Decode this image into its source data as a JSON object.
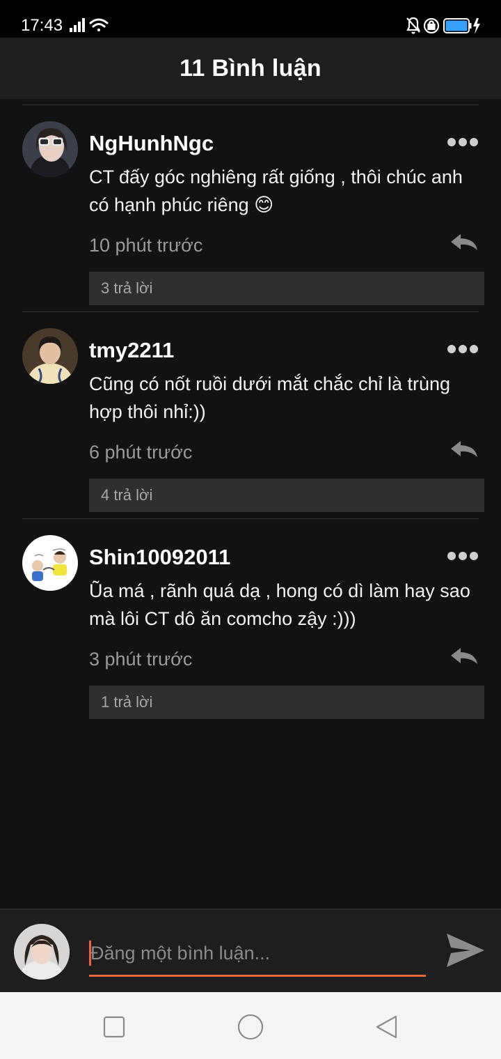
{
  "status_bar": {
    "time": "17:43",
    "icons": [
      "signal-icon",
      "wifi-icon",
      "bell-muted-icon",
      "lock-rotation-icon",
      "battery-icon",
      "charging-icon"
    ],
    "battery_color": "#3aa0ff"
  },
  "header": {
    "title": "11 Bình luận"
  },
  "comments": [
    {
      "username": "NgHunhNgc",
      "text": "CT đấy góc nghiêng rất giống , thôi chúc anh có hạnh phúc riêng 😊",
      "time": "10 phút trước",
      "replies": "3 trả lời"
    },
    {
      "username": "tmy2211",
      "text": "Cũng có nốt ruồi dưới mắt chắc chỉ là trùng hợp thôi nhỉ:))",
      "time": "6 phút trước",
      "replies": "4 trả lời"
    },
    {
      "username": "Shin10092011",
      "text": "Ũa má , rãnh quá dạ , hong có dì làm hay sao mà lôi CT dô ăn comcho zậy :)))",
      "time": "3 phút trước",
      "replies": "1 trả lời"
    }
  ],
  "input": {
    "placeholder": "Đăng một bình luận..."
  },
  "colors": {
    "accent": "#e8653a",
    "background": "#121212",
    "header": "#1e1e1e"
  },
  "nav": {
    "icons": [
      "square-icon",
      "circle-icon",
      "triangle-back-icon"
    ]
  }
}
